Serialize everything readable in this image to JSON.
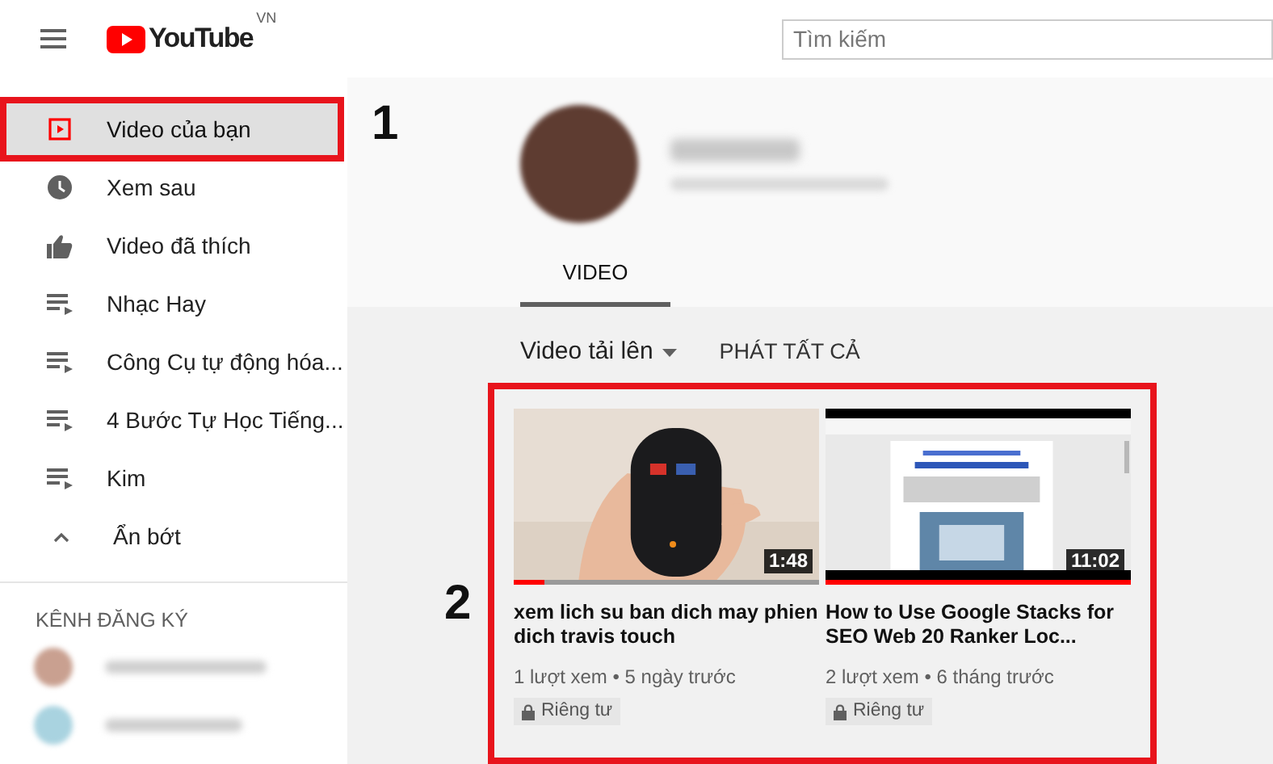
{
  "header": {
    "logo": "YouTube",
    "region": "VN",
    "search": {
      "placeholder": "Tìm kiếm"
    }
  },
  "sidebar": {
    "items": [
      {
        "kind": "uploads",
        "label": "Video của bạn",
        "selected": true
      },
      {
        "kind": "watch_later",
        "label": "Xem sau",
        "selected": false
      },
      {
        "kind": "liked",
        "label": "Video đã thích",
        "selected": false
      },
      {
        "kind": "playlist",
        "label": "Nhạc Hay",
        "selected": false
      },
      {
        "kind": "playlist",
        "label": "Công Cụ tự động hóa...",
        "selected": false
      },
      {
        "kind": "playlist",
        "label": "4 Bước Tự Học Tiếng...",
        "selected": false
      },
      {
        "kind": "playlist",
        "label": "Kim",
        "selected": false
      }
    ],
    "collapse": {
      "label": "Ẩn bớt"
    },
    "section_title": "KÊNH ĐĂNG KÝ",
    "subscriptions": [
      {
        "color": "#c9a090"
      },
      {
        "color": "#a9d3e0"
      }
    ]
  },
  "channel": {
    "tabs": [
      {
        "label": "VIDEO",
        "selected": true
      }
    ]
  },
  "toolbar": {
    "sort": "Video tải lên",
    "play_all": "PHÁT TẤT CẢ"
  },
  "videos": [
    {
      "kind": "picture",
      "title": "xem lich su ban dich may phien dich travis touch",
      "duration": "1:48",
      "level": 0.1,
      "meta": "1 lượt xem • 5 ngày trước",
      "privacy": "Riêng tư"
    },
    {
      "kind": "picture",
      "title": "How to Use Google Stacks for SEO Web 20 Ranker Loc...",
      "duration": "11:02",
      "level": 1,
      "meta": "2 lượt xem • 6 tháng trước",
      "privacy": "Riêng tư"
    }
  ],
  "annotations": [
    {
      "label": "1"
    },
    {
      "label": "2"
    }
  ]
}
